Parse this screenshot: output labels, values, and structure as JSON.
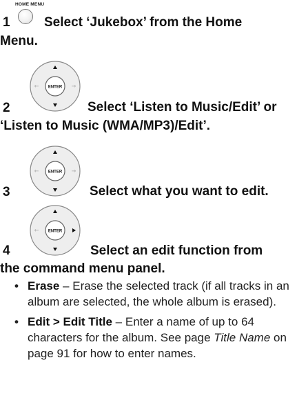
{
  "steps": [
    {
      "number": "1",
      "button_label": "HOME MENU",
      "text": "Select ‘Jukebox’ from the Home",
      "text_cont": "Menu."
    },
    {
      "number": "2",
      "button_label": "ENTER",
      "text": "Select ‘Listen to Music/Edit’ or",
      "text_cont": "‘Listen to Music (WMA/MP3)/Edit’."
    },
    {
      "number": "3",
      "button_label": "ENTER",
      "text": "Select what you want to edit."
    },
    {
      "number": "4",
      "button_label": "ENTER",
      "text": "Select an edit function from",
      "text_cont": "the command menu panel."
    }
  ],
  "bullets": [
    {
      "marker": "•",
      "term": "Erase",
      "text": " – Erase the selected track (if all tracks in an album are selected, the whole album is erased)."
    },
    {
      "marker": "•",
      "term": "Edit > Edit Title",
      "text_before": " – Enter a name of up to 64 characters for the album. See page ",
      "link_italic": "Title Name",
      "text_after": " on page 91 for how to enter names."
    }
  ]
}
